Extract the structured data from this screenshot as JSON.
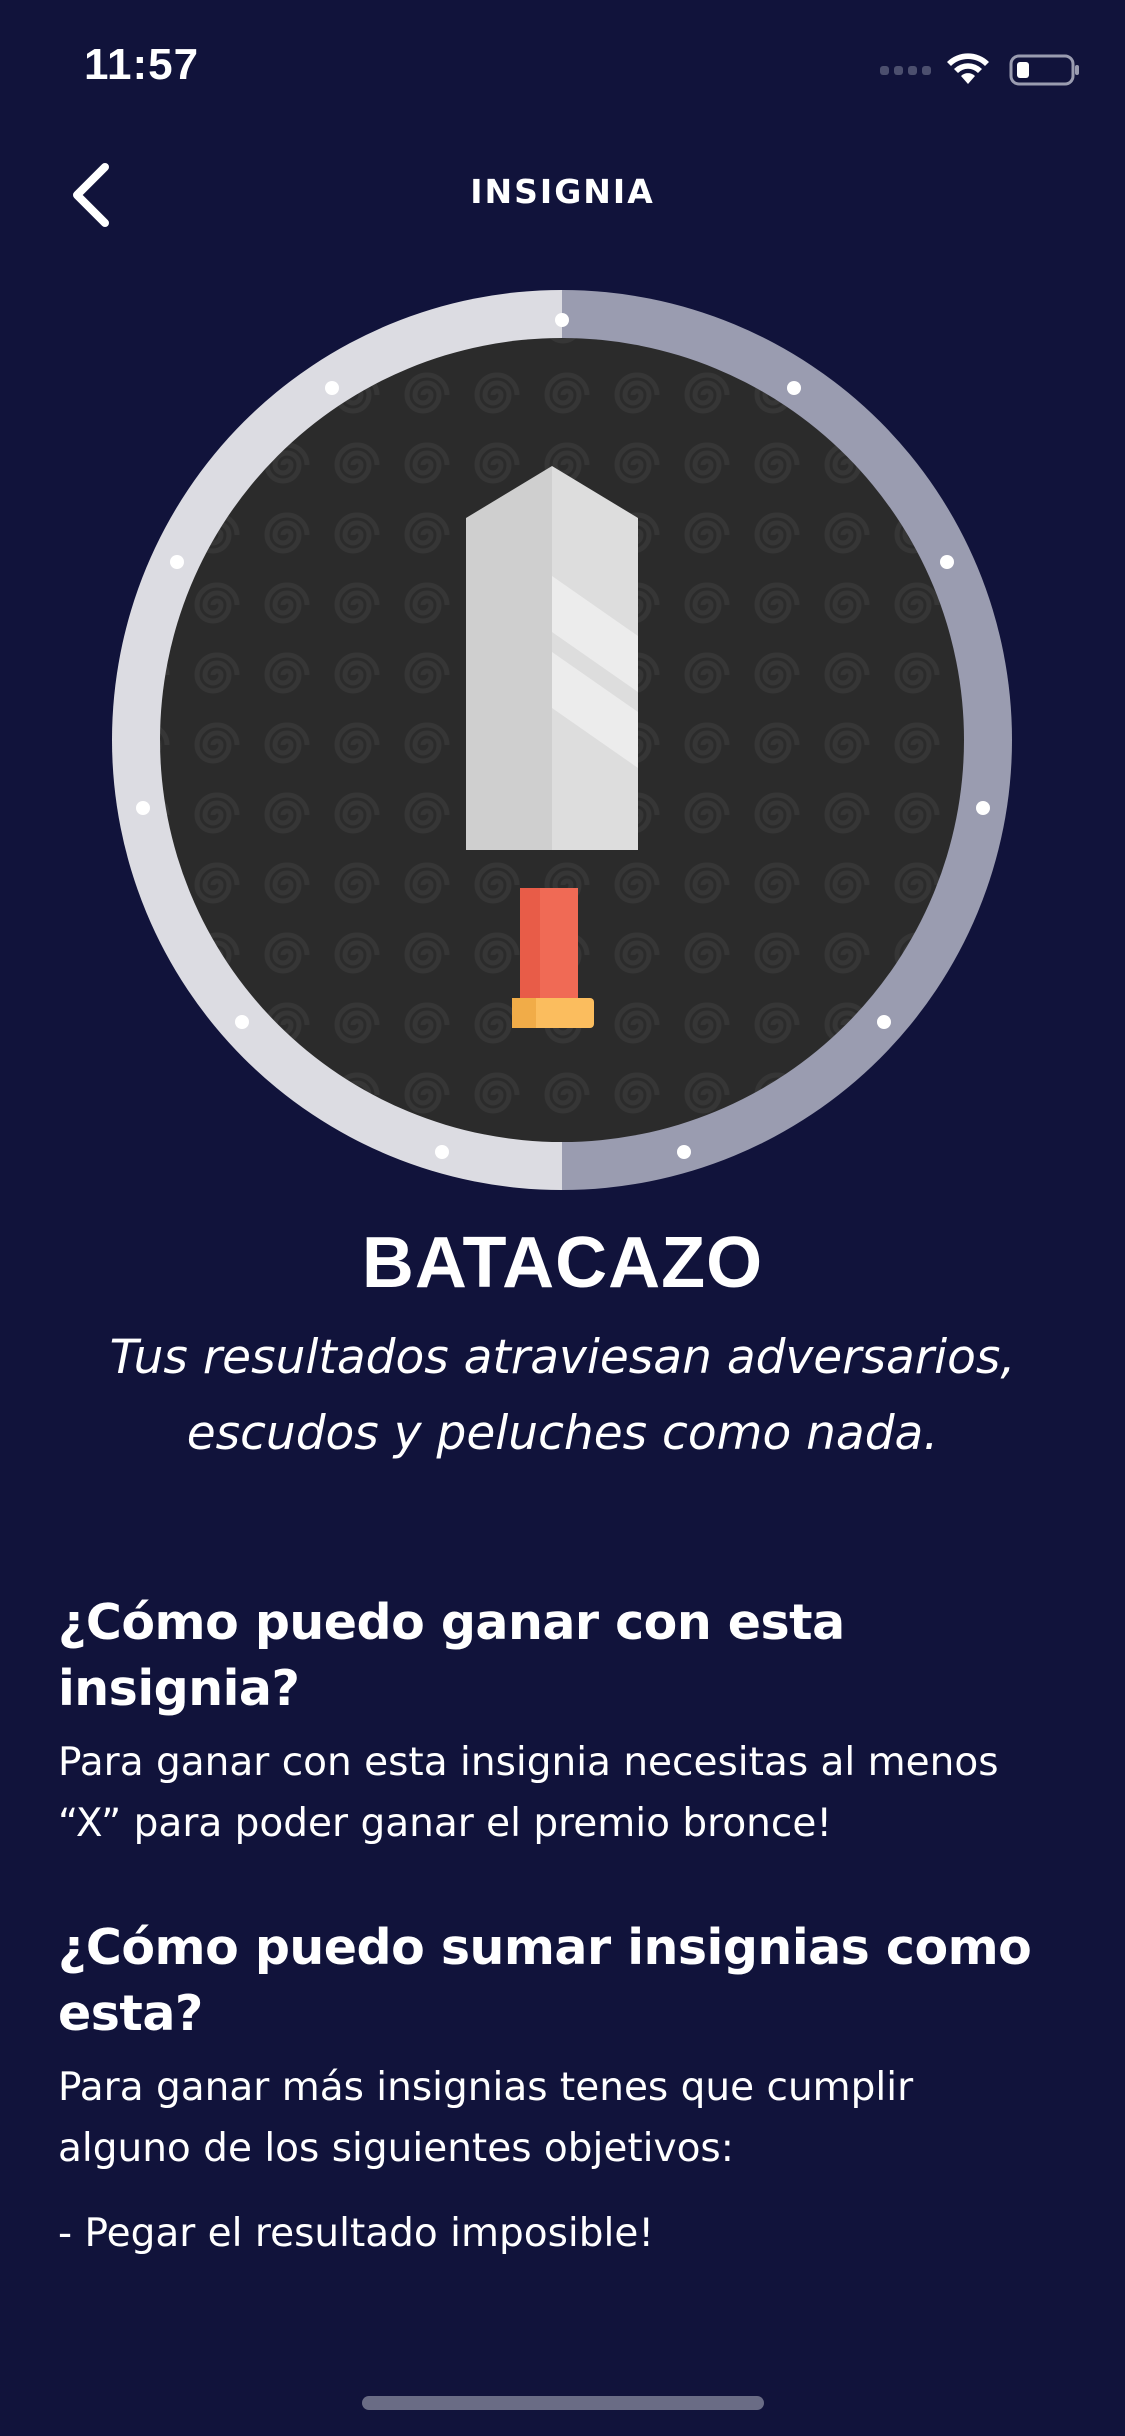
{
  "status_bar": {
    "time": "11:57",
    "icons": [
      "signal-icon",
      "wifi-icon",
      "battery-icon"
    ]
  },
  "nav": {
    "back_icon": "chevron-left-icon",
    "title": "INSIGNIA"
  },
  "badge": {
    "icon": "sword-shield-badge",
    "name": "BATACAZO",
    "description": "Tus resultados atraviesan adversarios, escudos y peluches como nada."
  },
  "sections": [
    {
      "heading": "¿Cómo puedo ganar con esta insignia?",
      "body": "Para ganar con esta insignia necesitas al menos “X” para poder ganar el premio bronce!"
    },
    {
      "heading": "¿Cómo puedo sumar insignias como esta?",
      "body": "Para ganar más insignias tenes que cumplir alguno de los siguientes objetivos:",
      "items": [
        "- Pegar el resultado imposible!"
      ]
    }
  ],
  "colors": {
    "background": "#11133b",
    "text": "#ffffff",
    "shield_rim_light": "#dcdce2",
    "shield_rim_dark": "#9a9cb0",
    "shield_inner": "#2b2b2b",
    "blade": "#cfcfcf",
    "guard": "#fbbd5e",
    "grip": "#f06a55"
  }
}
